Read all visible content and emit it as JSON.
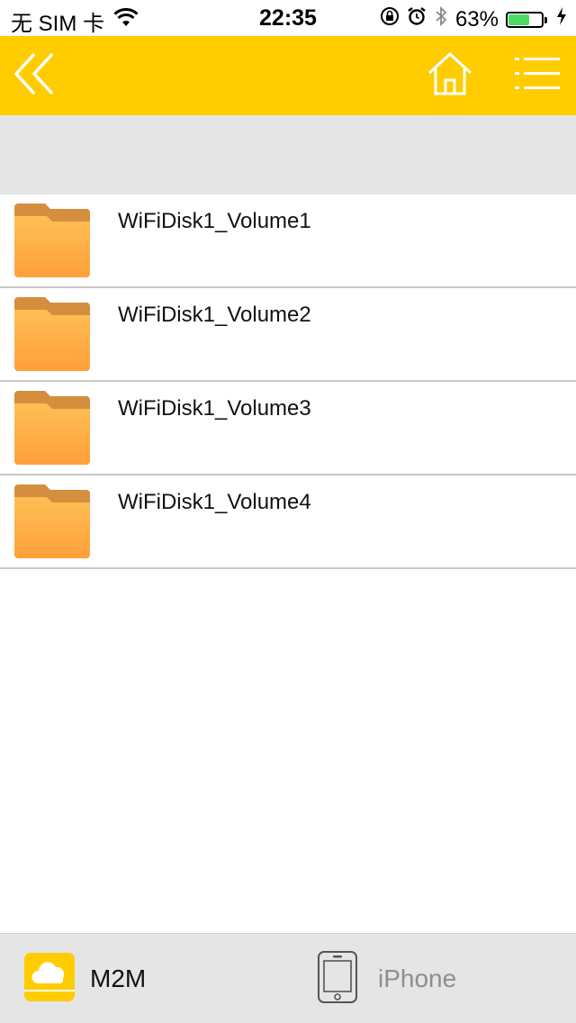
{
  "status_bar": {
    "carrier": "无 SIM 卡",
    "time": "22:35",
    "battery_percent": "63%",
    "battery_level": 0.63,
    "battery_color": "#4cd964",
    "icons": [
      "wifi-icon",
      "orientation-lock-icon",
      "alarm-icon",
      "bluetooth-icon",
      "battery-icon",
      "charging-icon"
    ]
  },
  "nav_bar": {
    "background": "#ffcc00",
    "icons": [
      "double-chevron-left-icon",
      "home-icon",
      "menu-icon"
    ]
  },
  "files": [
    {
      "name": "WiFiDisk1_Volume1",
      "icon": "folder-icon"
    },
    {
      "name": "WiFiDisk1_Volume2",
      "icon": "folder-icon"
    },
    {
      "name": "WiFiDisk1_Volume3",
      "icon": "folder-icon"
    },
    {
      "name": "WiFiDisk1_Volume4",
      "icon": "folder-icon"
    }
  ],
  "tab_bar": {
    "tabs": [
      {
        "label": "M2M",
        "icon": "cloud-drive-icon",
        "selected": true
      },
      {
        "label": "iPhone",
        "icon": "phone-icon",
        "selected": false
      }
    ]
  }
}
